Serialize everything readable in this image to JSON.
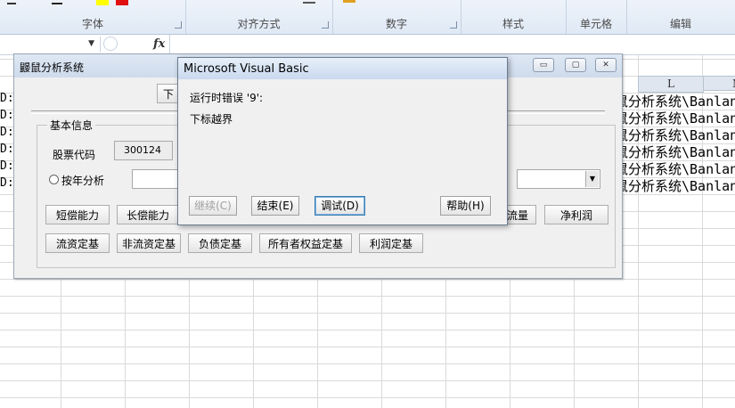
{
  "ribbon": {
    "groups": [
      "字体",
      "对齐方式",
      "数字",
      "样式",
      "单元格",
      "编辑"
    ]
  },
  "formula_bar": {
    "fx": "fx"
  },
  "sheet": {
    "col_l": "L",
    "col_m": "M",
    "left_cells": [
      "D:",
      "D:",
      "D:",
      "D:",
      "D:",
      "D:"
    ],
    "right_cells": [
      "鼠分析系统\\Banland",
      "鼠分析系统\\Banland",
      "鼠分析系统\\Banland",
      "鼠分析系统\\Banland",
      "鼠分析系统\\Banland",
      "鼠分析系统\\Banland"
    ]
  },
  "form": {
    "title": "鼹鼠分析系统",
    "top_button": "下",
    "legend": "基本信息",
    "stock_code_label": "股票代码",
    "stock_code_value": "300124",
    "yearly_label": "按年分析",
    "row1_buttons": [
      "短偿能力",
      "长偿能力",
      "流量",
      "净利润"
    ],
    "row2_buttons": [
      "流资定基",
      "非流资定基",
      "负债定基",
      "所有者权益定基",
      "利润定基"
    ]
  },
  "dialog": {
    "title": "Microsoft Visual Basic",
    "error_line": "运行时错误 '9':",
    "error_message": "下标越界",
    "buttons": {
      "continue": "继续(C)",
      "end": "结束(E)",
      "debug": "调试(D)",
      "help": "帮助(H)"
    }
  }
}
